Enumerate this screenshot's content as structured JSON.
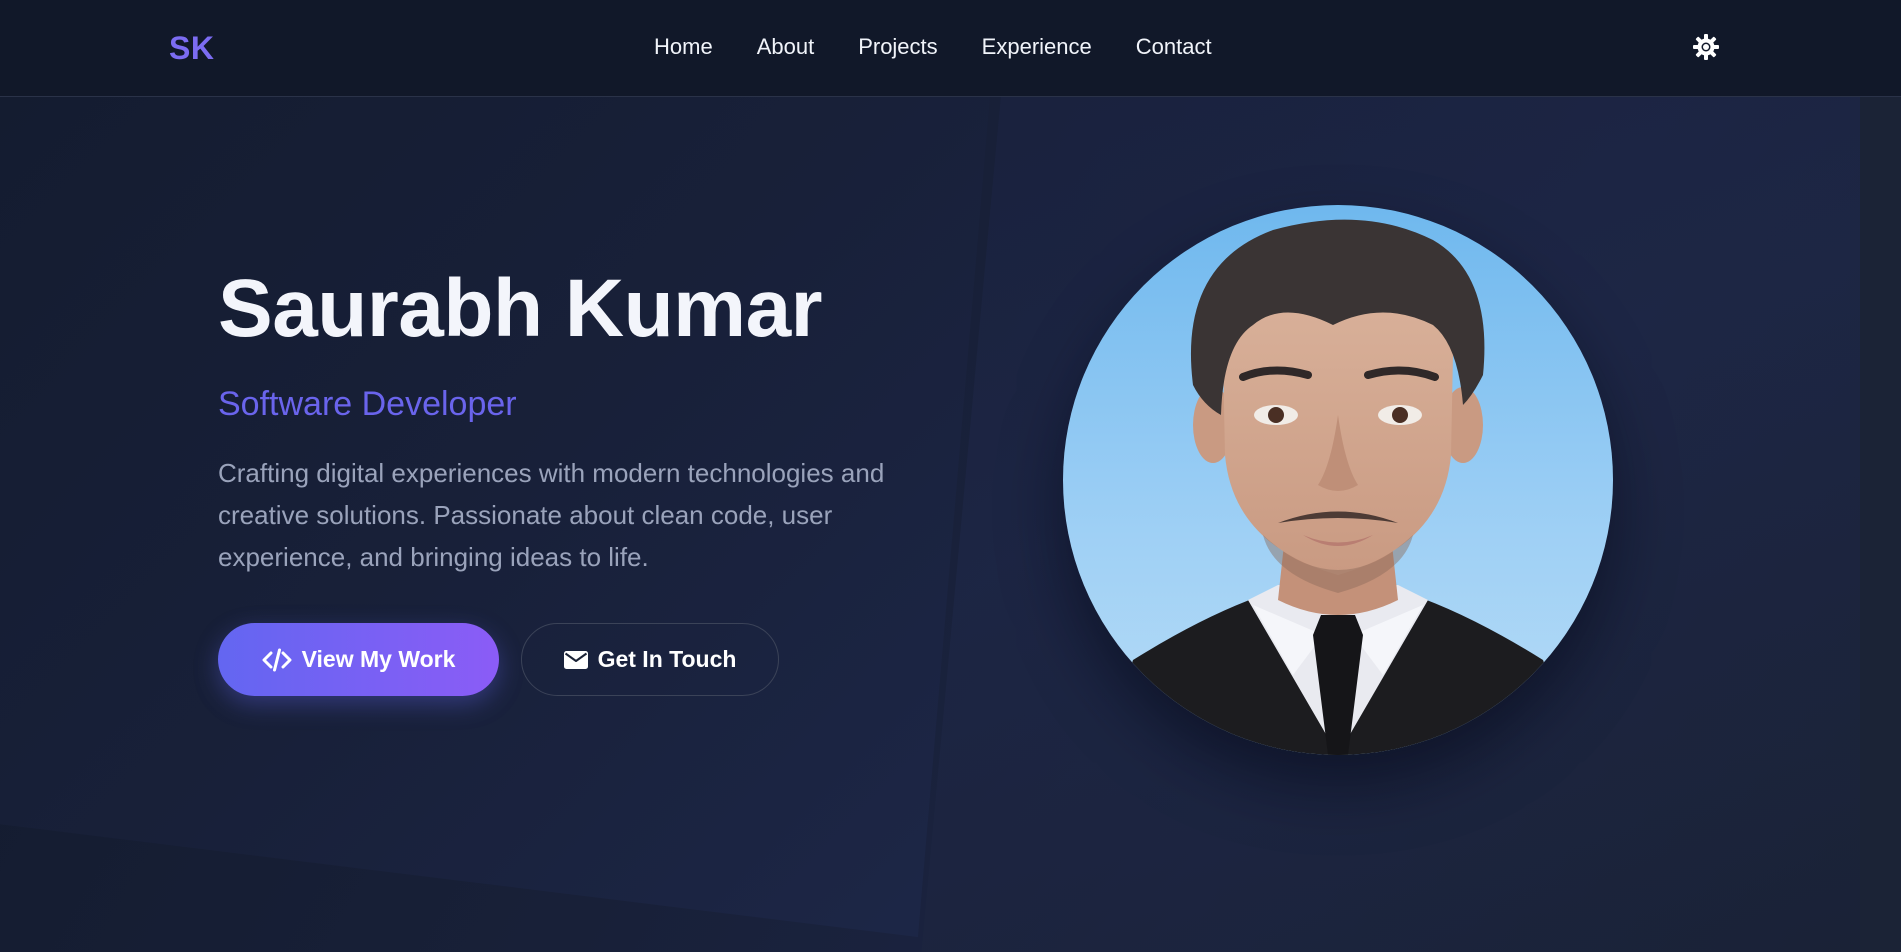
{
  "navbar": {
    "logo": "SK",
    "links": [
      "Home",
      "About",
      "Projects",
      "Experience",
      "Contact"
    ],
    "theme_toggle_icon": "sun-gear-icon"
  },
  "hero": {
    "name": "Saurabh Kumar",
    "role": "Software Developer",
    "description": "Crafting digital experiences with modern technologies and creative solutions. Passionate about clean code, user experience, and bringing ideas to life.",
    "primary_button": {
      "label": "View My Work",
      "icon": "code-icon"
    },
    "secondary_button": {
      "label": "Get In Touch",
      "icon": "envelope-icon"
    },
    "portrait_icon": "profile-photo"
  },
  "colors": {
    "accent": "#6366f1",
    "accent_end": "#8b5cf6",
    "logo": "#7c6cf2",
    "background": "#141b2e",
    "navbar": "#111829"
  }
}
